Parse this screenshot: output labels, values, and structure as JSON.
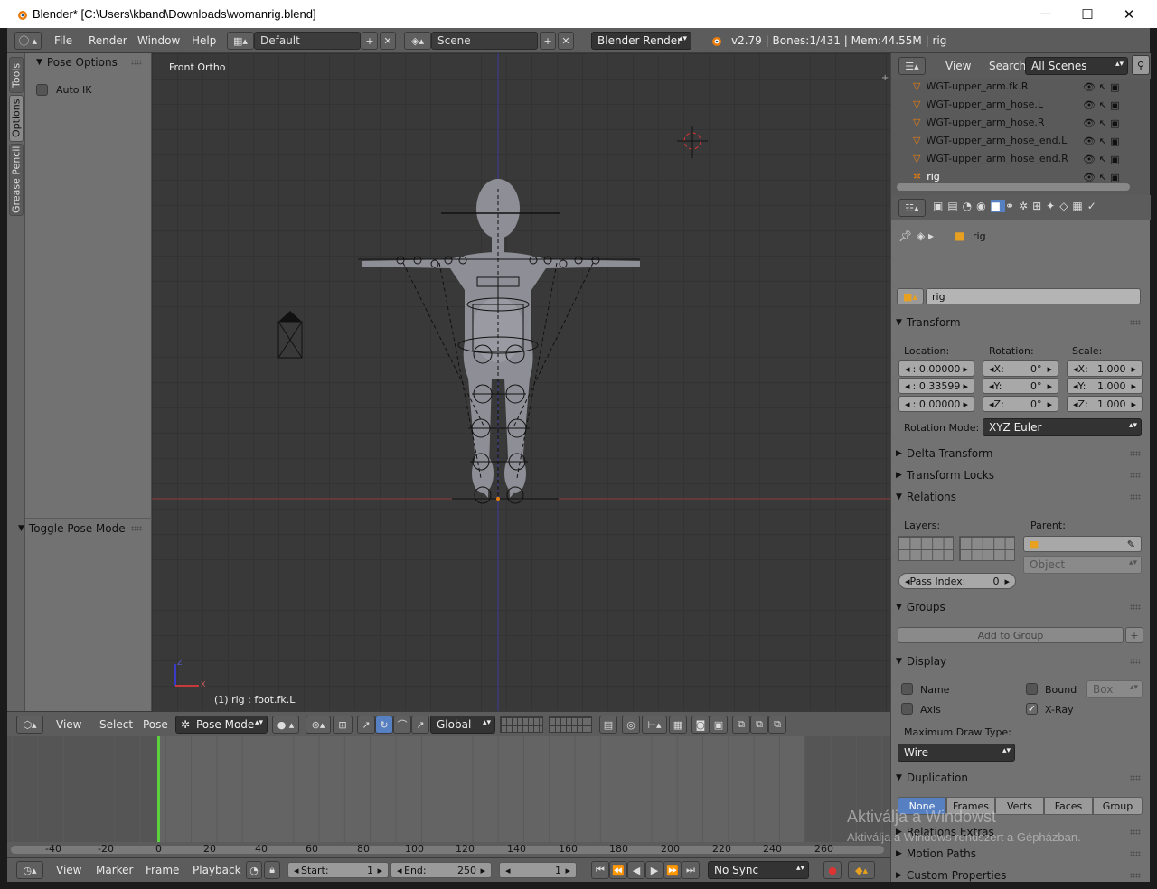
{
  "titlebar": {
    "title": "Blender* [C:\\Users\\kband\\Downloads\\womanrig.blend]",
    "minimize": "─",
    "maximize": "☐",
    "close": "✕"
  },
  "info": {
    "menus": [
      "File",
      "Render",
      "Window",
      "Help"
    ],
    "layout": "Default",
    "scene": "Scene",
    "engine": "Blender Render",
    "stats": "v2.79 | Bones:1/431 | Mem:44.55M | rig"
  },
  "shelf": {
    "tabs": [
      "Tools",
      "Options",
      "Grease Pencil"
    ],
    "pose_options": "Pose Options",
    "auto_ik": "Auto IK",
    "toggle_pose": "Toggle Pose Mode"
  },
  "viewport": {
    "view_name": "Front Ortho",
    "status": "(1) rig : foot.fk.L",
    "axis_z": "Z",
    "axis_x": "X"
  },
  "viewport_header": {
    "menus": [
      "View",
      "Select",
      "Pose"
    ],
    "mode": "Pose Mode",
    "orientation": "Global"
  },
  "timeline": {
    "ticks": [
      "-40",
      "-20",
      "0",
      "20",
      "40",
      "60",
      "80",
      "100",
      "120",
      "140",
      "160",
      "180",
      "200",
      "220",
      "240",
      "260"
    ],
    "menus": [
      "View",
      "Marker",
      "Frame",
      "Playback"
    ],
    "start_label": "Start:",
    "start": "1",
    "end_label": "End:",
    "end": "250",
    "current": "1",
    "sync": "No Sync"
  },
  "outliner": {
    "menus": [
      "View",
      "Search"
    ],
    "filter": "All Scenes",
    "rows": [
      "WGT-upper_arm.fk.R",
      "WGT-upper_arm_hose.L",
      "WGT-upper_arm_hose.R",
      "WGT-upper_arm_hose_end.L",
      "WGT-upper_arm_hose_end.R",
      "rig"
    ]
  },
  "properties": {
    "breadcrumb": "rig",
    "object_name": "rig",
    "transform": "Transform",
    "location_label": "Location:",
    "rotation_label": "Rotation:",
    "scale_label": "Scale:",
    "loc": [
      ":  0.00000",
      ":  0.33599",
      ":  0.00000"
    ],
    "rot_axes": [
      "X:",
      "Y:",
      "Z:"
    ],
    "rot": [
      "0°",
      "0°",
      "0°"
    ],
    "scale_axes": [
      "X:",
      "Y:",
      "Z:"
    ],
    "scale": [
      "1.000",
      "1.000",
      "1.000"
    ],
    "rotation_mode_label": "Rotation Mode:",
    "rotation_mode": "XYZ Euler",
    "delta_transform": "Delta Transform",
    "transform_locks": "Transform Locks",
    "relations": "Relations",
    "layers_label": "Layers:",
    "parent_label": "Parent:",
    "parent_type": "Object",
    "pass_index_label": "Pass Index:",
    "pass_index": "0",
    "groups": "Groups",
    "add_to_group": "Add to Group",
    "display": "Display",
    "name": "Name",
    "bound": "Bound",
    "bound_type": "Box",
    "axis": "Axis",
    "xray": "X-Ray",
    "max_draw_type_label": "Maximum Draw Type:",
    "max_draw_type": "Wire",
    "duplication": "Duplication",
    "dup_options": [
      "None",
      "Frames",
      "Verts",
      "Faces",
      "Group"
    ],
    "relations_extras": "Relations Extras",
    "motion_paths": "Motion Paths",
    "custom_properties": "Custom Properties"
  },
  "watermark": {
    "line1": "Aktiválja a Windowst",
    "line2": "Aktiválja a Windows rendszert a Gépházban."
  },
  "colors": {
    "accent_blue": "#5680c2",
    "timeline_cursor": "#5bd13f"
  }
}
